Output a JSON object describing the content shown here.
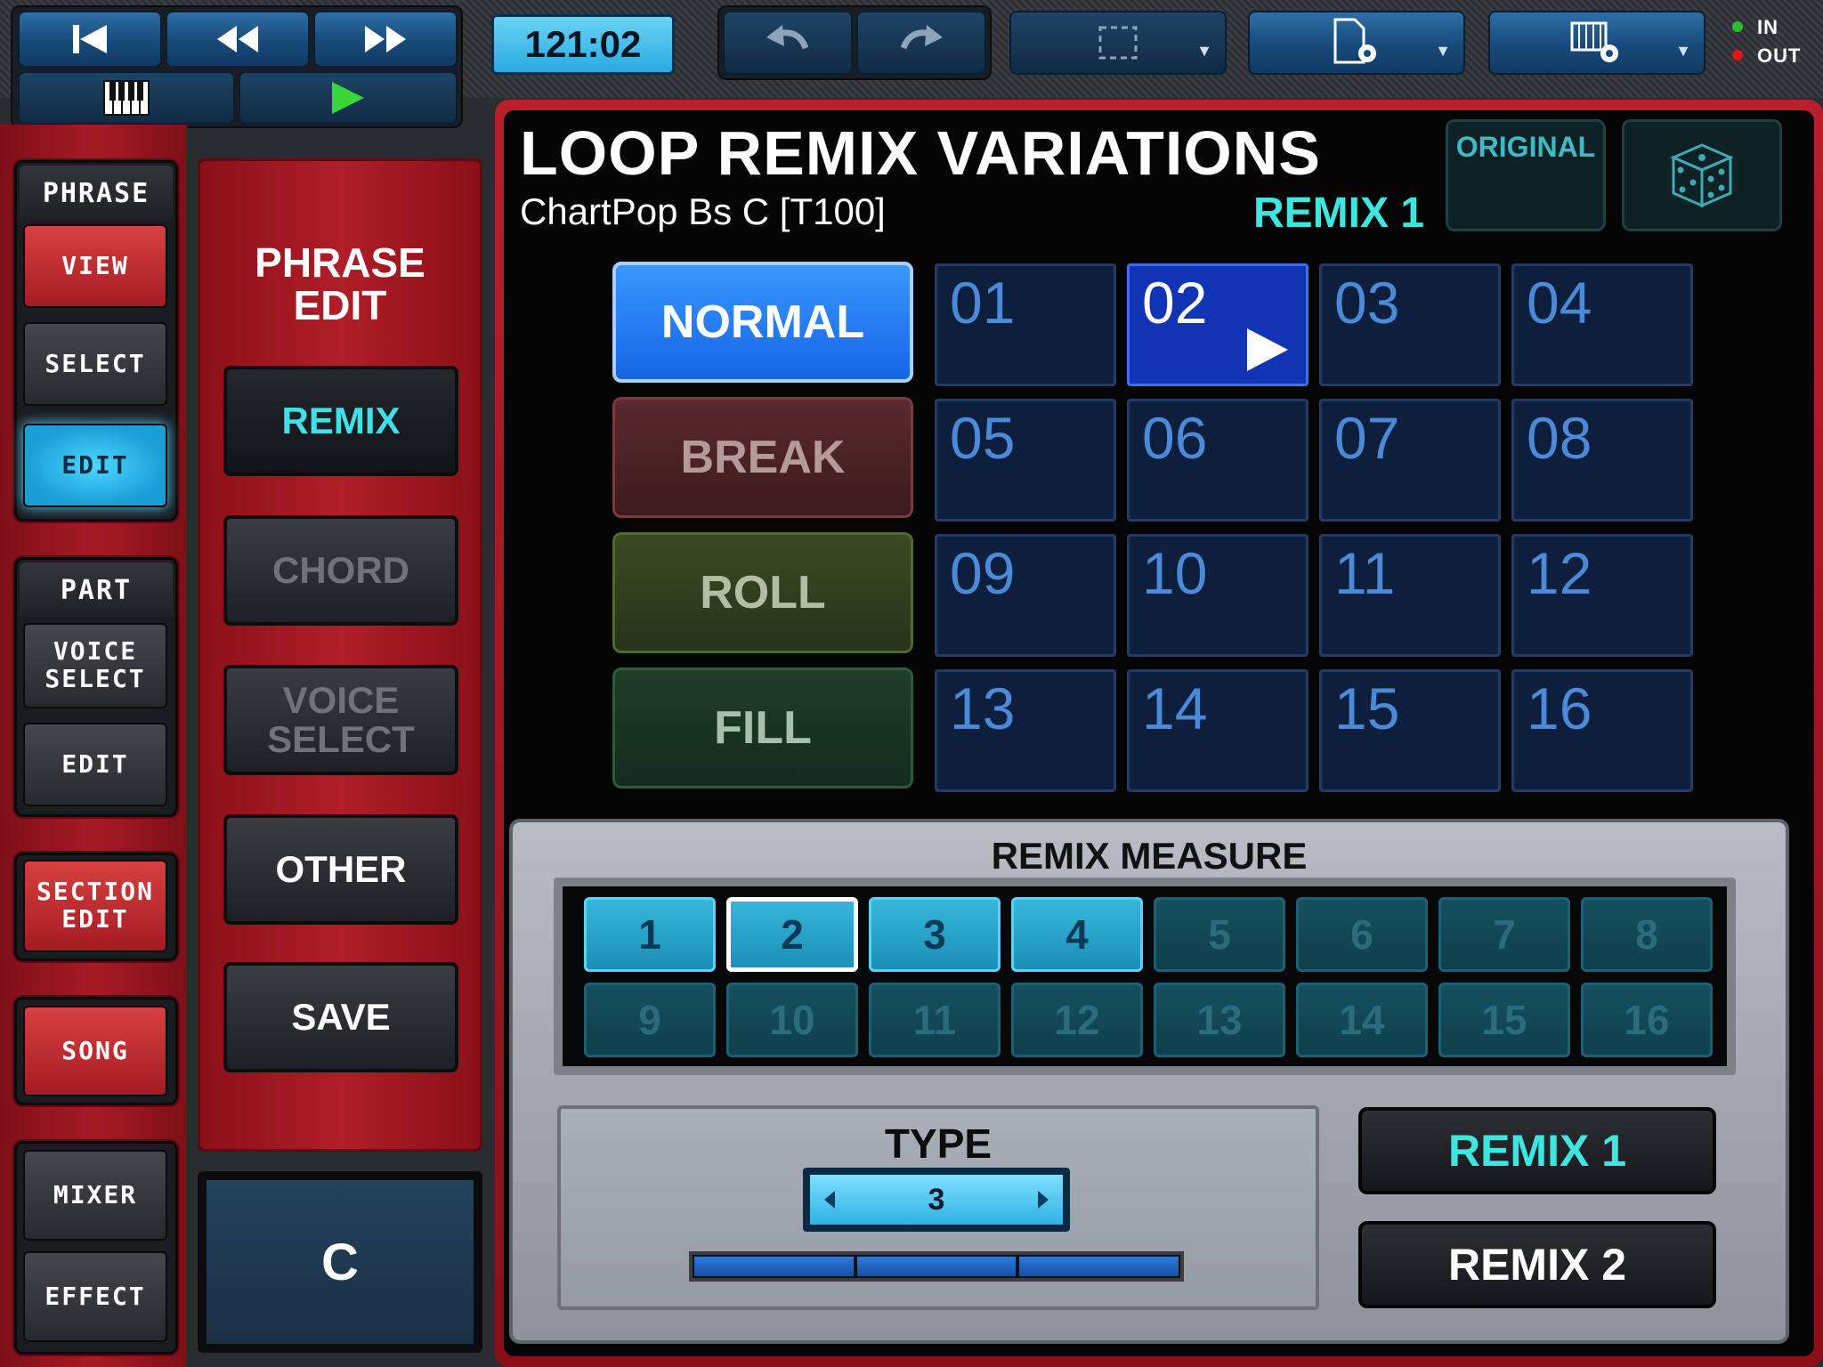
{
  "top_bar": {
    "time": "121:02",
    "io_in": "IN",
    "io_out": "OUT",
    "colors": {
      "play": "#39d639",
      "led_in": "#2bbd2b",
      "led_out": "#e0161c"
    }
  },
  "left_nav": {
    "phrase_header": "PHRASE",
    "phrase_view": "VIEW",
    "phrase_select": "SELECT",
    "phrase_edit": "EDIT",
    "part_header": "PART",
    "part_voice_select": "VOICE\nSELECT",
    "part_edit": "EDIT",
    "section_edit": "SECTION\nEDIT",
    "song": "SONG",
    "mixer": "MIXER",
    "effect": "EFFECT"
  },
  "side_panel": {
    "title": "PHRASE\nEDIT",
    "buttons": [
      "REMIX",
      "CHORD",
      "VOICE\nSELECT",
      "OTHER",
      "SAVE"
    ],
    "key": "C"
  },
  "main": {
    "title": "LOOP REMIX VARIATIONS",
    "subtitle": "ChartPop Bs C [T100]",
    "current_remix": "REMIX 1",
    "original_label": "ORIGINAL",
    "modes": [
      "NORMAL",
      "BREAK",
      "ROLL",
      "FILL"
    ],
    "variations": [
      "01",
      "02",
      "03",
      "04",
      "05",
      "06",
      "07",
      "08",
      "09",
      "10",
      "11",
      "12",
      "13",
      "14",
      "15",
      "16"
    ],
    "selected_variation": "02"
  },
  "remix_measure": {
    "title": "REMIX MEASURE",
    "cells": [
      "1",
      "2",
      "3",
      "4",
      "5",
      "6",
      "7",
      "8",
      "9",
      "10",
      "11",
      "12",
      "13",
      "14",
      "15",
      "16"
    ],
    "lit_count": 4,
    "current": "2"
  },
  "type": {
    "title": "TYPE",
    "value": "3"
  },
  "remix_buttons": [
    "REMIX 1",
    "REMIX 2"
  ]
}
